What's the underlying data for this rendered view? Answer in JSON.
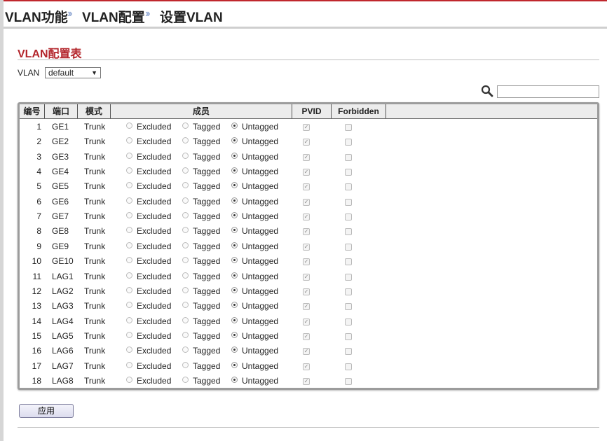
{
  "breadcrumb": {
    "item1": "VLAN功能",
    "sep": "››",
    "item2": "VLAN配置",
    "item3": "设置VLAN"
  },
  "section": {
    "title": "VLAN配置表"
  },
  "vlan_filter": {
    "label": "VLAN",
    "selected": "default"
  },
  "search": {
    "value": ""
  },
  "table": {
    "headers": {
      "no": "编号",
      "port": "端口",
      "mode": "模式",
      "member": "成员",
      "pvid": "PVID",
      "forbidden": "Forbidden"
    },
    "options": {
      "excluded": "Excluded",
      "tagged": "Tagged",
      "untagged": "Untagged"
    },
    "rows": [
      {
        "no": "1",
        "port": "GE1",
        "mode": "Trunk",
        "member": "untagged",
        "pvid": true,
        "forbidden": false
      },
      {
        "no": "2",
        "port": "GE2",
        "mode": "Trunk",
        "member": "untagged",
        "pvid": true,
        "forbidden": false
      },
      {
        "no": "3",
        "port": "GE3",
        "mode": "Trunk",
        "member": "untagged",
        "pvid": true,
        "forbidden": false
      },
      {
        "no": "4",
        "port": "GE4",
        "mode": "Trunk",
        "member": "untagged",
        "pvid": true,
        "forbidden": false
      },
      {
        "no": "5",
        "port": "GE5",
        "mode": "Trunk",
        "member": "untagged",
        "pvid": true,
        "forbidden": false
      },
      {
        "no": "6",
        "port": "GE6",
        "mode": "Trunk",
        "member": "untagged",
        "pvid": true,
        "forbidden": false
      },
      {
        "no": "7",
        "port": "GE7",
        "mode": "Trunk",
        "member": "untagged",
        "pvid": true,
        "forbidden": false
      },
      {
        "no": "8",
        "port": "GE8",
        "mode": "Trunk",
        "member": "untagged",
        "pvid": true,
        "forbidden": false
      },
      {
        "no": "9",
        "port": "GE9",
        "mode": "Trunk",
        "member": "untagged",
        "pvid": true,
        "forbidden": false
      },
      {
        "no": "10",
        "port": "GE10",
        "mode": "Trunk",
        "member": "untagged",
        "pvid": true,
        "forbidden": false
      },
      {
        "no": "11",
        "port": "LAG1",
        "mode": "Trunk",
        "member": "untagged",
        "pvid": true,
        "forbidden": false
      },
      {
        "no": "12",
        "port": "LAG2",
        "mode": "Trunk",
        "member": "untagged",
        "pvid": true,
        "forbidden": false
      },
      {
        "no": "13",
        "port": "LAG3",
        "mode": "Trunk",
        "member": "untagged",
        "pvid": true,
        "forbidden": false
      },
      {
        "no": "14",
        "port": "LAG4",
        "mode": "Trunk",
        "member": "untagged",
        "pvid": true,
        "forbidden": false
      },
      {
        "no": "15",
        "port": "LAG5",
        "mode": "Trunk",
        "member": "untagged",
        "pvid": true,
        "forbidden": false
      },
      {
        "no": "16",
        "port": "LAG6",
        "mode": "Trunk",
        "member": "untagged",
        "pvid": true,
        "forbidden": false
      },
      {
        "no": "17",
        "port": "LAG7",
        "mode": "Trunk",
        "member": "untagged",
        "pvid": true,
        "forbidden": false
      },
      {
        "no": "18",
        "port": "LAG8",
        "mode": "Trunk",
        "member": "untagged",
        "pvid": true,
        "forbidden": false
      }
    ]
  },
  "apply_button": {
    "label": "应用"
  },
  "colors": {
    "accent": "#b3262c",
    "top_line": "#c0272d",
    "separator": "#9bb0d8"
  },
  "icons": {
    "search": "search-icon",
    "dropdown": "chevron-down-icon"
  }
}
